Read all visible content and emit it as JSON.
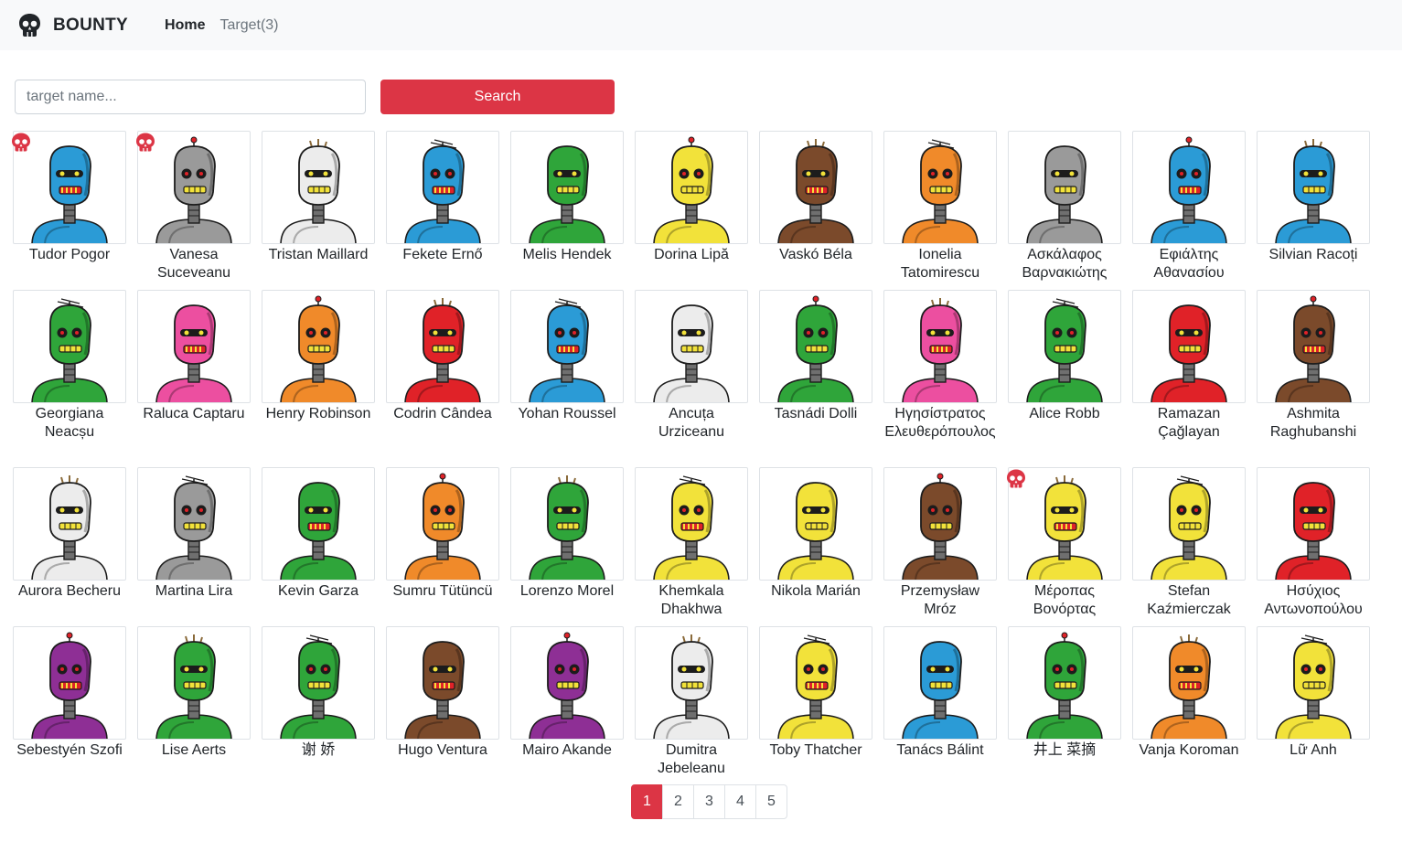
{
  "nav": {
    "brand": "BOUNTY",
    "links": [
      {
        "label": "Home",
        "active": true
      },
      {
        "label": "Target(3)",
        "active": false
      }
    ]
  },
  "search": {
    "placeholder": "target name...",
    "value": "",
    "button_label": "Search"
  },
  "colors": {
    "accent": "#dc3545",
    "blue": "#2b9bd6",
    "gray": "#9a9a9a",
    "white": "#ececec",
    "green": "#2fa53a",
    "yellow": "#f2e23a",
    "brown": "#7b4a2b",
    "orange": "#f08a2a",
    "pink": "#ec4fa0",
    "red": "#e02228",
    "purple": "#8e2f95"
  },
  "targets": [
    {
      "name": "Tudor Pogor",
      "color": "blue",
      "targeted": true
    },
    {
      "name": "Vanesa Suceveanu",
      "color": "gray",
      "targeted": true
    },
    {
      "name": "Tristan Maillard",
      "color": "white",
      "targeted": false
    },
    {
      "name": "Fekete Ernő",
      "color": "blue",
      "targeted": false
    },
    {
      "name": "Melis Hendek",
      "color": "green",
      "targeted": false
    },
    {
      "name": "Dorina Lipă",
      "color": "yellow",
      "targeted": false
    },
    {
      "name": "Vaskó Béla",
      "color": "brown",
      "targeted": false
    },
    {
      "name": "Ionelia Tatomirescu",
      "color": "orange",
      "targeted": false
    },
    {
      "name": "Ασκάλαφος Βαρνακιώτης",
      "color": "gray",
      "targeted": false
    },
    {
      "name": "Εφιάλτης Αθανασίου",
      "color": "blue",
      "targeted": false
    },
    {
      "name": "Silvian Racoți",
      "color": "blue",
      "targeted": false
    },
    {
      "name": "Georgiana Neacșu",
      "color": "green",
      "targeted": false
    },
    {
      "name": "Raluca Captaru",
      "color": "pink",
      "targeted": false
    },
    {
      "name": "Henry Robinson",
      "color": "orange",
      "targeted": false
    },
    {
      "name": "Codrin Cândea",
      "color": "red",
      "targeted": false
    },
    {
      "name": "Yohan Roussel",
      "color": "blue",
      "targeted": false
    },
    {
      "name": "Ancuța Urziceanu",
      "color": "white",
      "targeted": false
    },
    {
      "name": "Tasnádi Dolli",
      "color": "green",
      "targeted": false
    },
    {
      "name": "Ηγησίστρατος Ελευθερόπουλος",
      "color": "pink",
      "targeted": false
    },
    {
      "name": "Alice Robb",
      "color": "green",
      "targeted": false
    },
    {
      "name": "Ramazan Çağlayan",
      "color": "red",
      "targeted": false
    },
    {
      "name": "Ashmita Raghubanshi",
      "color": "brown",
      "targeted": false
    },
    {
      "name": "Aurora Becheru",
      "color": "white",
      "targeted": false
    },
    {
      "name": "Martina Lira",
      "color": "gray",
      "targeted": false
    },
    {
      "name": "Kevin Garza",
      "color": "green",
      "targeted": false
    },
    {
      "name": "Sumru Tütüncü",
      "color": "orange",
      "targeted": false
    },
    {
      "name": "Lorenzo Morel",
      "color": "green",
      "targeted": false
    },
    {
      "name": "Khemkala Dhakhwa",
      "color": "yellow",
      "targeted": false
    },
    {
      "name": "Nikola Marián",
      "color": "yellow",
      "targeted": false
    },
    {
      "name": "Przemysław Mróz",
      "color": "brown",
      "targeted": false
    },
    {
      "name": "Μέροπας Βονόρτας",
      "color": "yellow",
      "targeted": true
    },
    {
      "name": "Stefan Kaźmierczak",
      "color": "yellow",
      "targeted": false
    },
    {
      "name": "Ησύχιος Αντωνοπούλου",
      "color": "red",
      "targeted": false
    },
    {
      "name": "Sebestyén Szofi",
      "color": "purple",
      "targeted": false
    },
    {
      "name": "Lise Aerts",
      "color": "green",
      "targeted": false
    },
    {
      "name": "谢 娇",
      "color": "green",
      "targeted": false
    },
    {
      "name": "Hugo Ventura",
      "color": "brown",
      "targeted": false
    },
    {
      "name": "Mairo Akande",
      "color": "purple",
      "targeted": false
    },
    {
      "name": "Dumitra Jebeleanu",
      "color": "white",
      "targeted": false
    },
    {
      "name": "Toby Thatcher",
      "color": "yellow",
      "targeted": false
    },
    {
      "name": "Tanács Bálint",
      "color": "blue",
      "targeted": false
    },
    {
      "name": "井上 菜摘",
      "color": "green",
      "targeted": false
    },
    {
      "name": "Vanja Koroman",
      "color": "orange",
      "targeted": false
    },
    {
      "name": "Lữ Anh",
      "color": "yellow",
      "targeted": false
    }
  ],
  "pagination": {
    "pages": [
      "1",
      "2",
      "3",
      "4",
      "5"
    ],
    "current": "1"
  }
}
